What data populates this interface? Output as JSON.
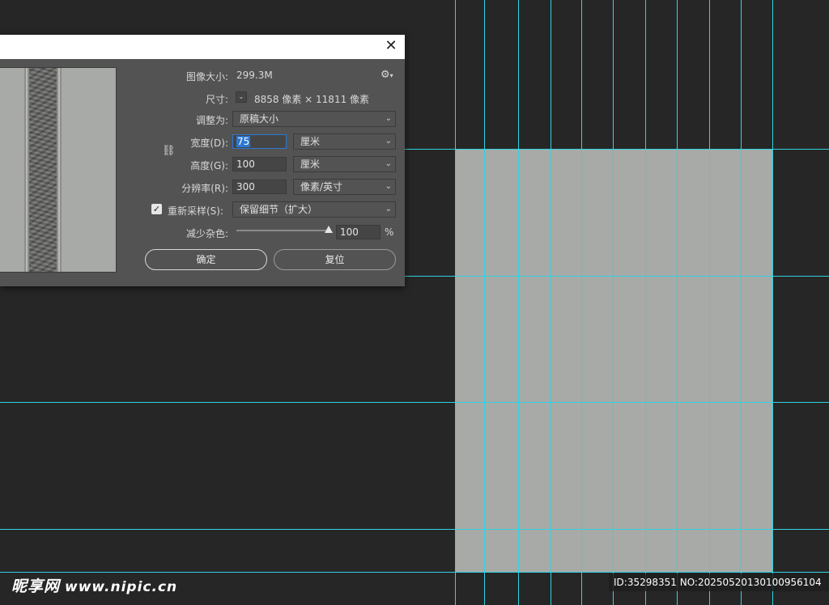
{
  "dialog": {
    "close_glyph": "✕",
    "image_size_label": "图像大小:",
    "image_size_value": "299.3M",
    "settings_icon": "gear-icon",
    "settings_glyph": "⚙",
    "dimensions_label": "尺寸:",
    "dimensions_value": "8858 像素 × 11811 像素",
    "fit_to_label": "调整为:",
    "fit_to_value": "原稿大小",
    "width_label": "宽度(D):",
    "width_value": "75",
    "width_unit": "厘米",
    "height_label": "高度(G):",
    "height_value": "100",
    "height_unit": "厘米",
    "resolution_label": "分辨率(R):",
    "resolution_value": "300",
    "resolution_unit": "像素/英寸",
    "resample_label": "重新采样(S):",
    "resample_checked": true,
    "resample_value": "保留细节（扩大）",
    "reduce_noise_label": "减少杂色:",
    "reduce_noise_value": "100",
    "reduce_noise_unit": "%",
    "ok_label": "确定",
    "reset_label": "复位",
    "link_icon": "chain-link-icon"
  },
  "watermark": {
    "site_name": "昵享网",
    "site_url": "www.nipic.cn",
    "id_text": "ID:35298351 NO:20250520130100956104"
  },
  "colors": {
    "canvas_bg": "#262626",
    "guide": "#2fd3e0",
    "tile": "#a8aaa7",
    "dialog_bg": "#535353",
    "focus": "#2c78d3"
  }
}
